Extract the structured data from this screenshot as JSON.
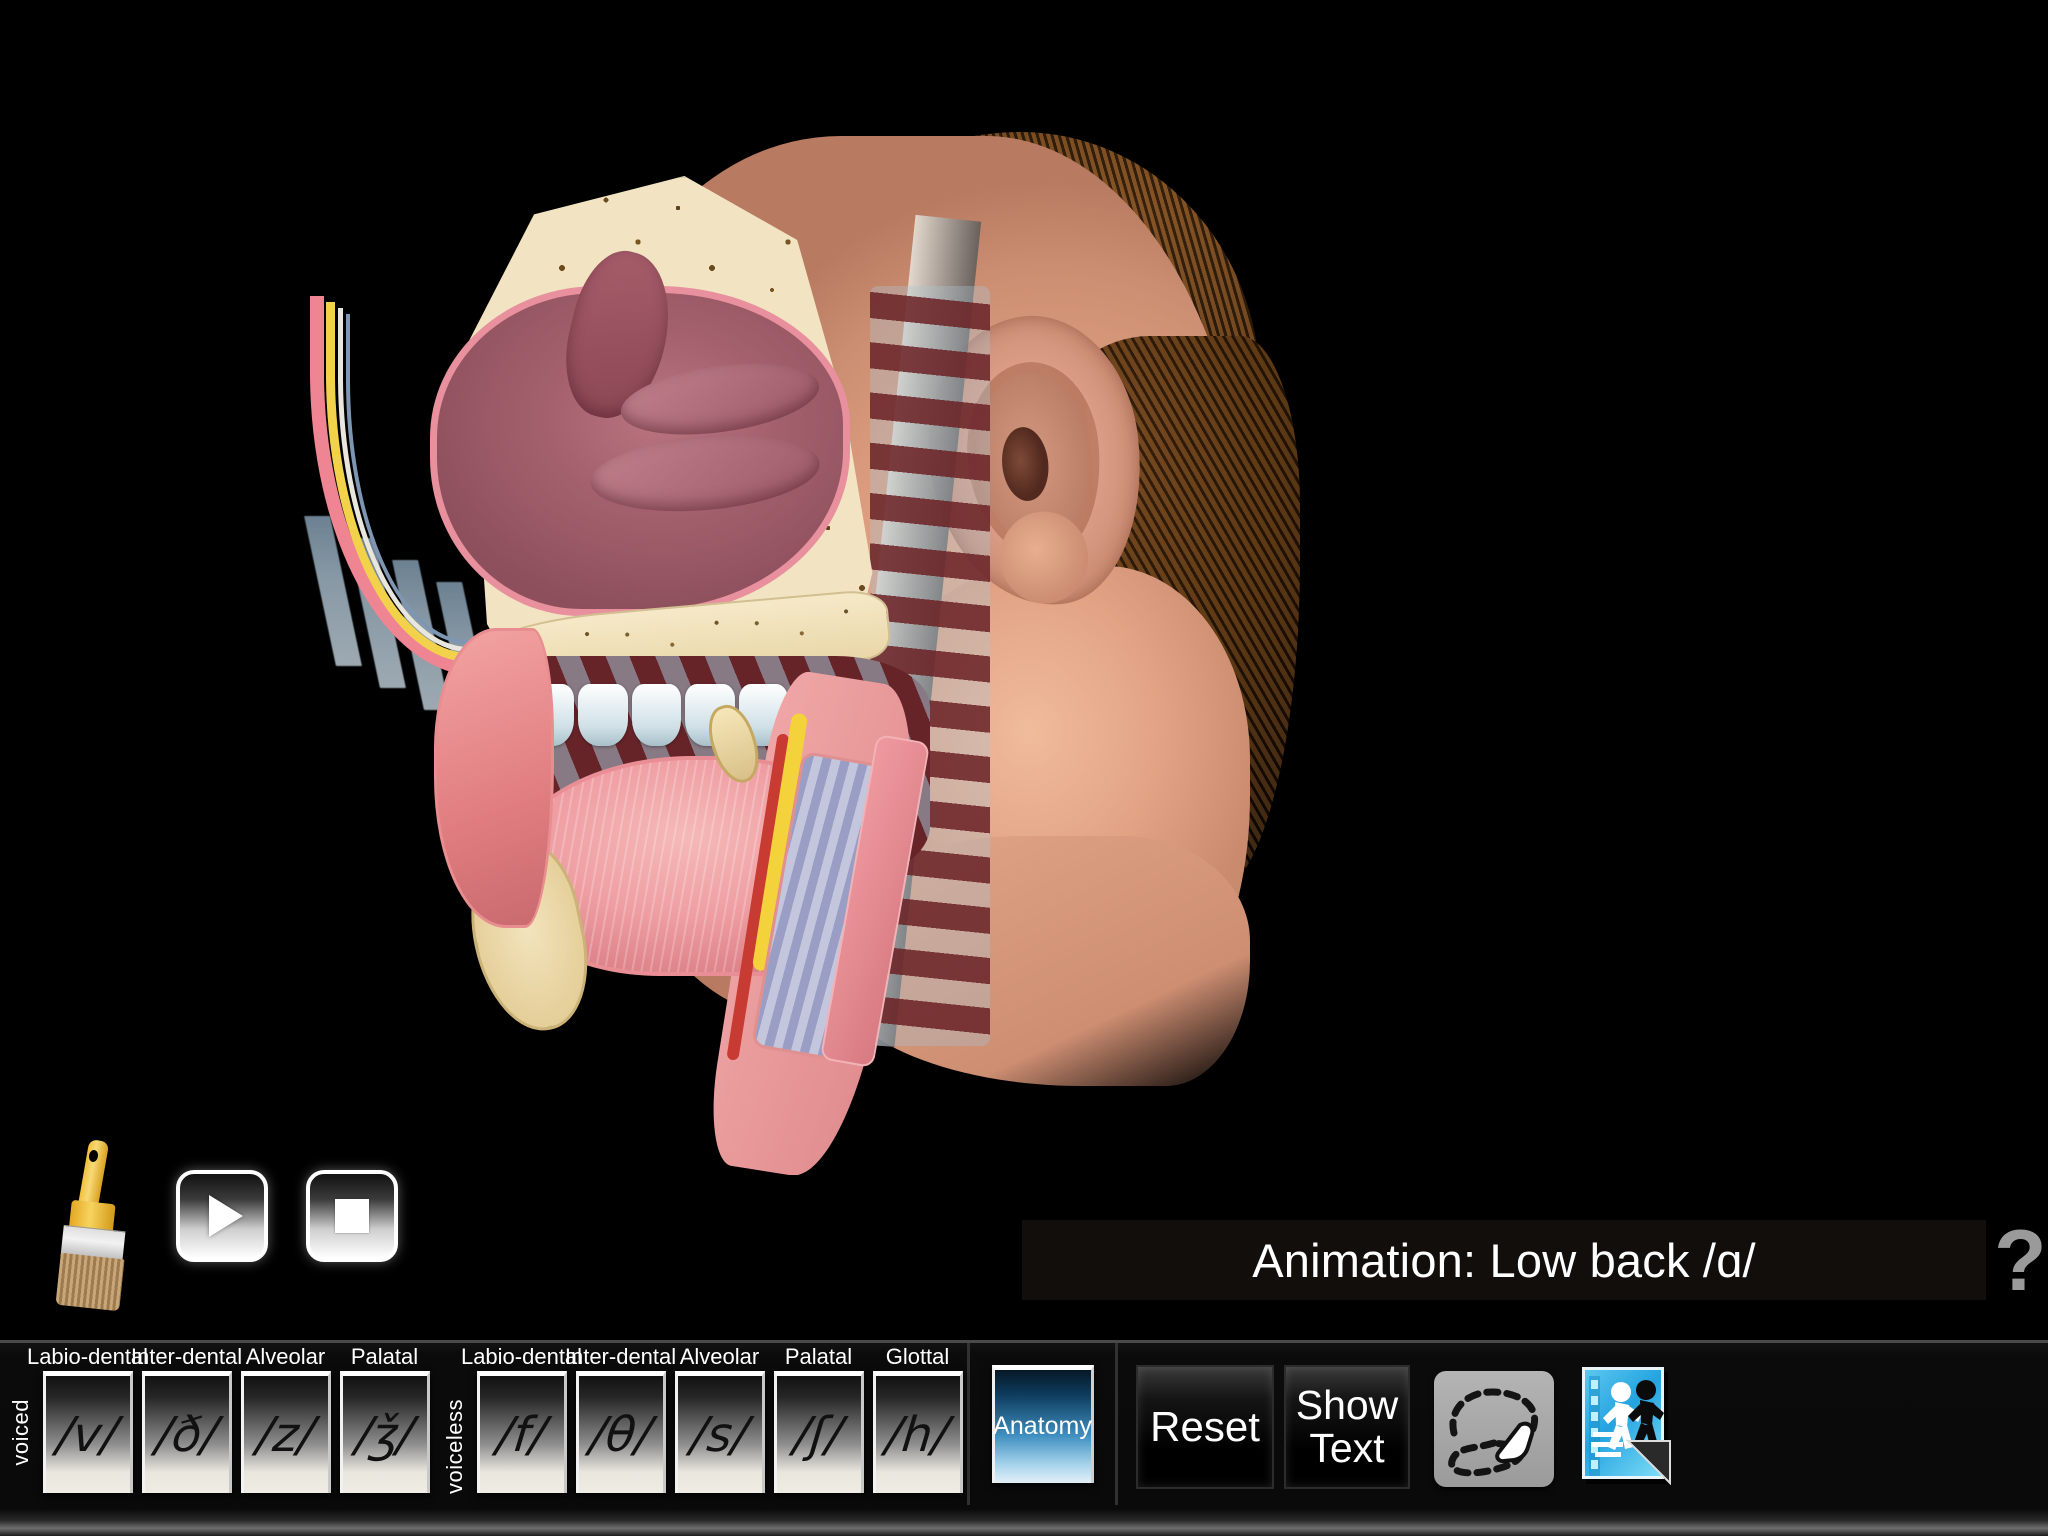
{
  "app": {
    "background_color": "#000000",
    "accent_color": "#3f8fc0"
  },
  "stage": {
    "name": "sagittal-head-anatomy-illustration",
    "description": "Mid-sagittal section of human head showing nasal cavity, hard palate, tongue, teeth, pharynx, larynx and trachea with airflow bands exiting the mouth",
    "airflow_bands": 4
  },
  "controls": {
    "brush_icon": "paintbrush-icon",
    "play_label": "▶",
    "stop_label": "■",
    "title": "Animation: Low back /ɑ/",
    "help_label": "?"
  },
  "toolbar": {
    "voiced_label": "voiced",
    "voiceless_label": "voiceless",
    "voiced_phonemes": [
      {
        "place": "Labio-dental",
        "symbol": "/v/"
      },
      {
        "place": "Inter-dental",
        "symbol": "/ð/"
      },
      {
        "place": "Alveolar",
        "symbol": "/z/"
      },
      {
        "place": "Palatal",
        "symbol": "/ǯ/"
      }
    ],
    "voiceless_phonemes": [
      {
        "place": "Labio-dental",
        "symbol": "/f/"
      },
      {
        "place": "Inter-dental",
        "symbol": "/θ/"
      },
      {
        "place": "Alveolar",
        "symbol": "/s/"
      },
      {
        "place": "Palatal",
        "symbol": "/ʃ/"
      },
      {
        "place": "Glottal",
        "symbol": "/h/"
      }
    ],
    "anatomy_label": "Anatomy",
    "reset_label": "Reset",
    "show_text_label": "Show\nText",
    "show_text_line1": "Show",
    "show_text_line2": "Text",
    "trace_icon": "dashed-outline-hand-trace-icon",
    "animation_icon": "film-runner-animation-icon"
  }
}
